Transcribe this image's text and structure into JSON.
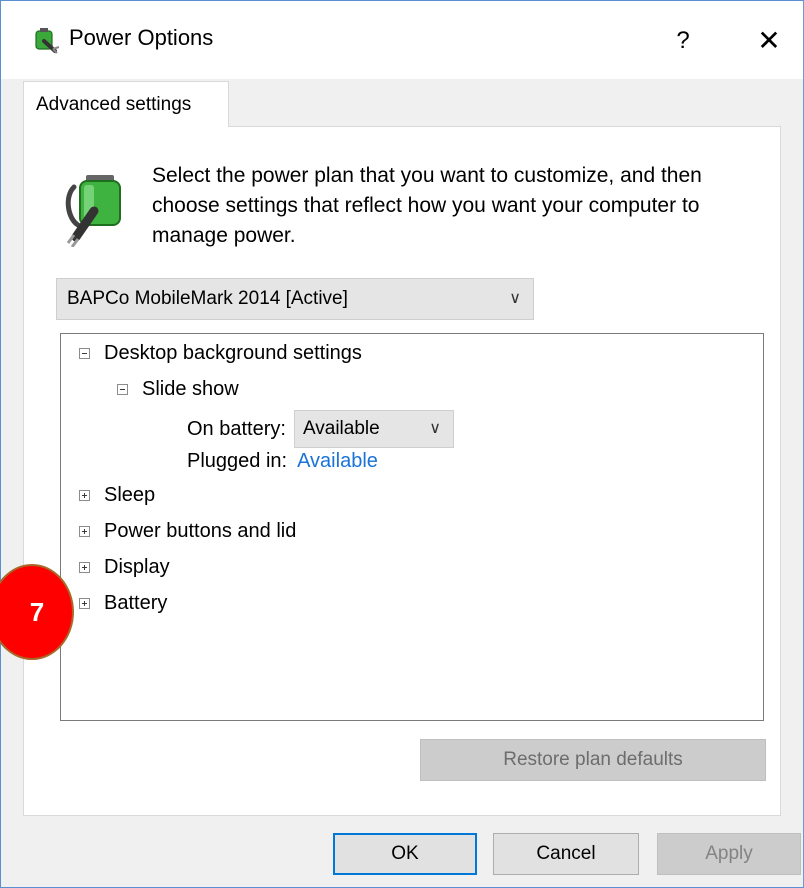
{
  "window": {
    "title": "Power Options",
    "help_label": "?",
    "close_label": "✕"
  },
  "tabs": [
    {
      "label": "Advanced settings",
      "selected": true
    }
  ],
  "description": "Select the power plan that you want to customize, and then choose settings that reflect how you want your computer to manage power.",
  "plan_select": {
    "value": "BAPCo MobileMark 2014 [Active]"
  },
  "tree": {
    "desktop": {
      "label": "Desktop background settings",
      "expanded": true
    },
    "slideshow": {
      "label": "Slide show",
      "expanded": true
    },
    "on_battery": {
      "label": "On battery:",
      "value": "Available"
    },
    "plugged_in": {
      "label": "Plugged in:",
      "value": "Available"
    },
    "sleep": {
      "label": "Sleep"
    },
    "power_buttons": {
      "label": "Power buttons and lid"
    },
    "display": {
      "label": "Display"
    },
    "battery": {
      "label": "Battery"
    }
  },
  "buttons": {
    "restore": "Restore plan defaults",
    "ok": "OK",
    "cancel": "Cancel",
    "apply": "Apply"
  },
  "callout": {
    "number": "7",
    "color": "#ff0000"
  },
  "colors": {
    "link": "#1a73d6",
    "focus_border": "#0078d7",
    "window_border": "#5a8fd1"
  }
}
